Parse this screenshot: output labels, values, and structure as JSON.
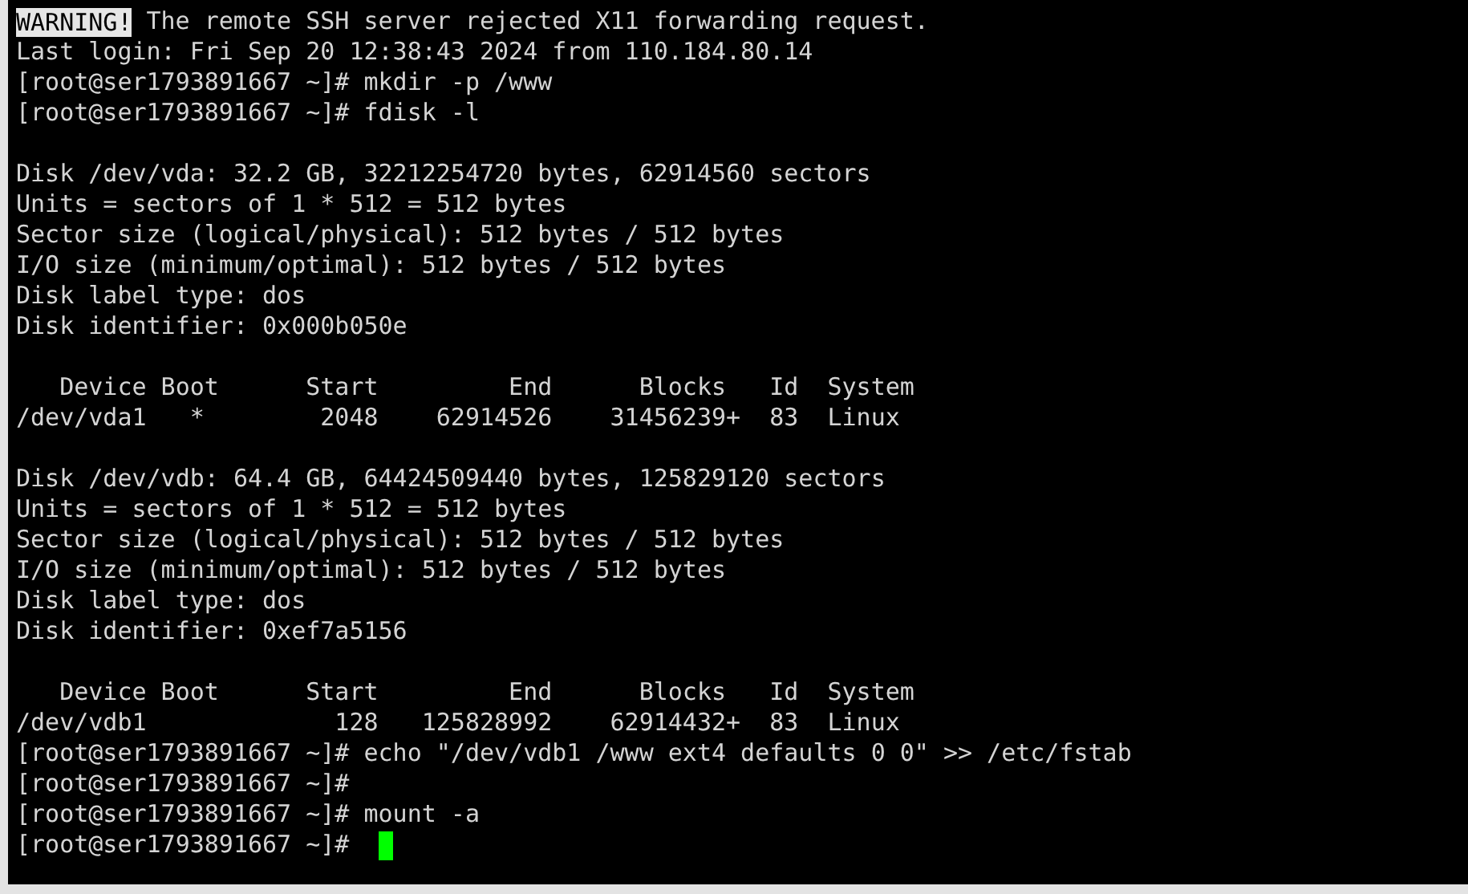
{
  "terminal": {
    "warning": {
      "badge": "WARNING!",
      "message": "The remote SSH server rejected X11 forwarding request."
    },
    "lines": [
      {
        "kind": "text",
        "text": "Last login: Fri Sep 20 12:38:43 2024 from 110.184.80.14"
      },
      {
        "kind": "text",
        "text": "[root@ser1793891667 ~]# mkdir -p /www"
      },
      {
        "kind": "text",
        "text": "[root@ser1793891667 ~]# fdisk -l"
      },
      {
        "kind": "blank"
      },
      {
        "kind": "text",
        "text": "Disk /dev/vda: 32.2 GB, 32212254720 bytes, 62914560 sectors"
      },
      {
        "kind": "text",
        "text": "Units = sectors of 1 * 512 = 512 bytes"
      },
      {
        "kind": "text",
        "text": "Sector size (logical/physical): 512 bytes / 512 bytes"
      },
      {
        "kind": "text",
        "text": "I/O size (minimum/optimal): 512 bytes / 512 bytes"
      },
      {
        "kind": "text",
        "text": "Disk label type: dos"
      },
      {
        "kind": "text",
        "text": "Disk identifier: 0x000b050e"
      },
      {
        "kind": "blank"
      },
      {
        "kind": "text",
        "text": "   Device Boot      Start         End      Blocks   Id  System"
      },
      {
        "kind": "text",
        "text": "/dev/vda1   *        2048    62914526    31456239+  83  Linux"
      },
      {
        "kind": "blank"
      },
      {
        "kind": "text",
        "text": "Disk /dev/vdb: 64.4 GB, 64424509440 bytes, 125829120 sectors"
      },
      {
        "kind": "text",
        "text": "Units = sectors of 1 * 512 = 512 bytes"
      },
      {
        "kind": "text",
        "text": "Sector size (logical/physical): 512 bytes / 512 bytes"
      },
      {
        "kind": "text",
        "text": "I/O size (minimum/optimal): 512 bytes / 512 bytes"
      },
      {
        "kind": "text",
        "text": "Disk label type: dos"
      },
      {
        "kind": "text",
        "text": "Disk identifier: 0xef7a5156"
      },
      {
        "kind": "blank"
      },
      {
        "kind": "text",
        "text": "   Device Boot      Start         End      Blocks   Id  System"
      },
      {
        "kind": "text",
        "text": "/dev/vdb1             128   125828992    62914432+  83  Linux"
      },
      {
        "kind": "text",
        "text": "[root@ser1793891667 ~]# echo \"/dev/vdb1 /www ext4 defaults 0 0\" >> /etc/fstab"
      },
      {
        "kind": "text",
        "text": "[root@ser1793891667 ~]#"
      },
      {
        "kind": "text",
        "text": "[root@ser1793891667 ~]# mount -a"
      }
    ],
    "prompt": {
      "text": "[root@ser1793891667 ~]#",
      "cursor": true
    }
  }
}
